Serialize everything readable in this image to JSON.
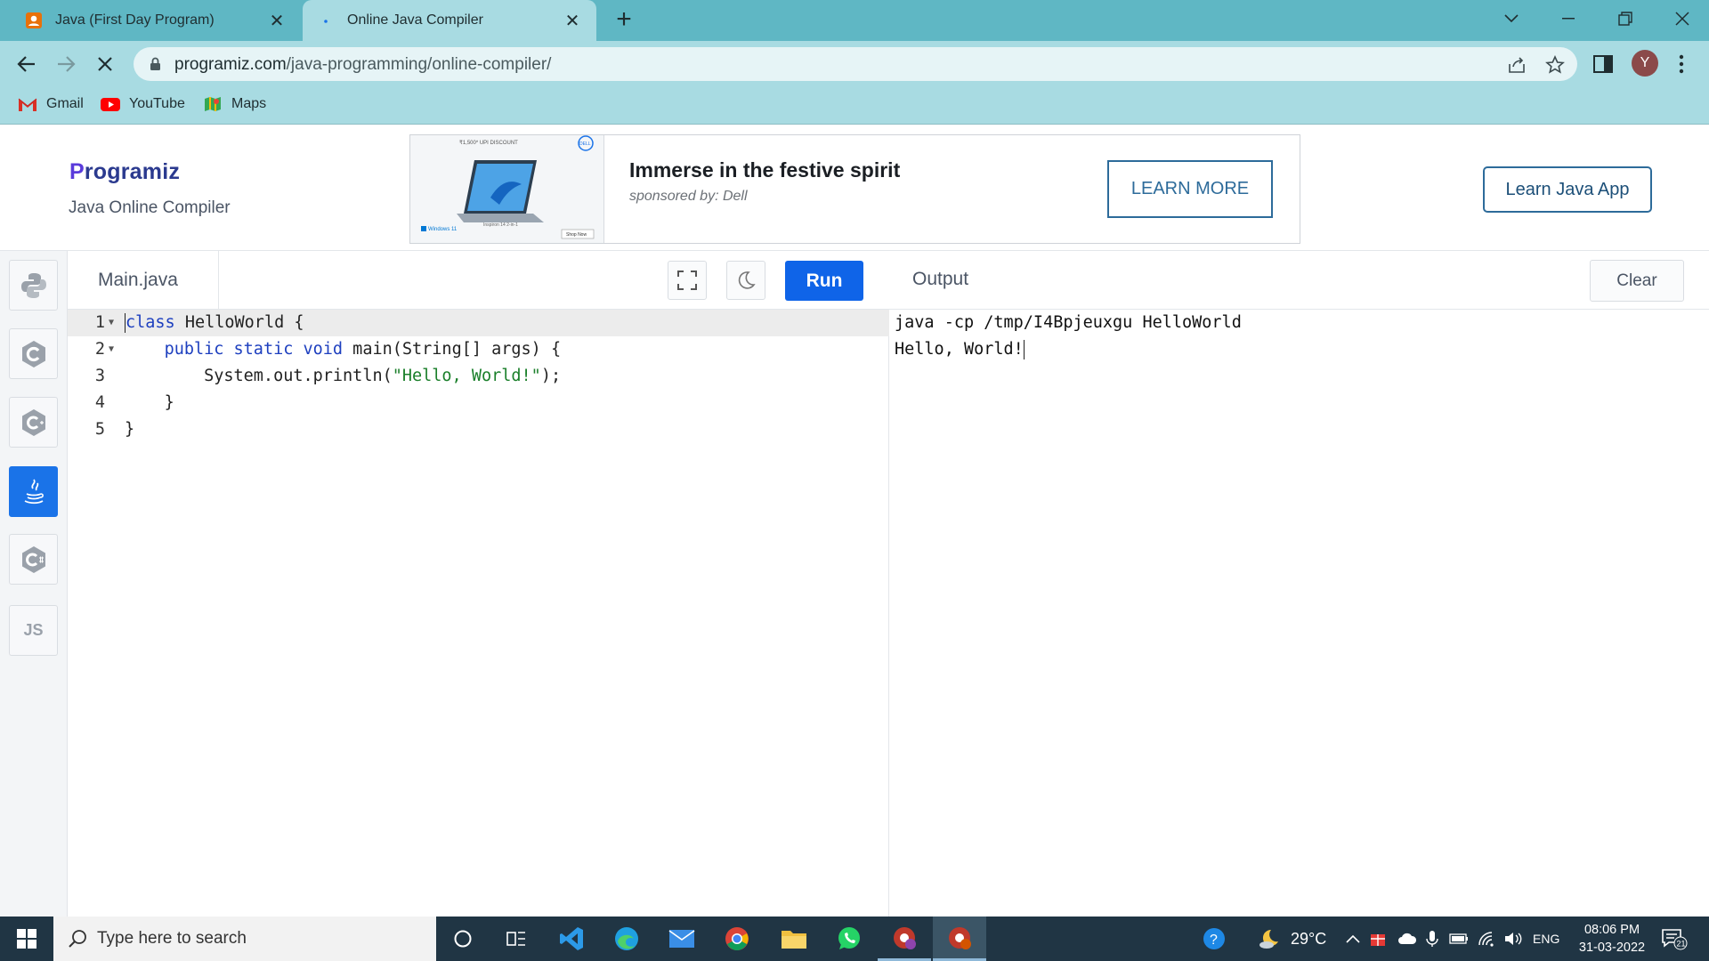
{
  "browser": {
    "tabs": [
      {
        "title": "Java (First Day Program)",
        "icon": "person-badge-icon",
        "active": false
      },
      {
        "title": "Online Java Compiler",
        "icon": "loading-dot-icon",
        "active": true
      }
    ],
    "url_domain": "programiz.com",
    "url_path": "/java-programming/online-compiler/",
    "profile_initial": "Y",
    "bookmarks": [
      {
        "label": "Gmail",
        "icon": "gmail-icon"
      },
      {
        "label": "YouTube",
        "icon": "youtube-icon"
      },
      {
        "label": "Maps",
        "icon": "maps-icon"
      }
    ]
  },
  "header": {
    "logo": "rogramiz",
    "logo_mark": "P",
    "subtitle": "Java Online Compiler",
    "ad": {
      "headline": "Immerse in the festive spirit",
      "sponsor": "sponsored by: Dell",
      "cta": "LEARN MORE",
      "image_badge": "DELL",
      "image_offer": "₹1,500* UPI DISCOUNT",
      "image_brand": "Windows 11",
      "image_model": "Inspiron 14 2-in-1",
      "image_shop": "Shop Now"
    },
    "learn_app": "Learn Java App"
  },
  "sidebar": {
    "languages": [
      {
        "name": "python",
        "label": ""
      },
      {
        "name": "c",
        "label": ""
      },
      {
        "name": "cpp",
        "label": ""
      },
      {
        "name": "java",
        "label": "",
        "active": true
      },
      {
        "name": "csharp",
        "label": ""
      },
      {
        "name": "javascript",
        "label": "JS"
      }
    ]
  },
  "editor": {
    "file_name": "Main.java",
    "run_label": "Run",
    "lines": [
      {
        "num": "1",
        "kw": "class",
        "rest": " HelloWorld {"
      },
      {
        "num": "2",
        "indent": "    ",
        "kw": "public static void",
        "rest": " main(String[] args) {"
      },
      {
        "num": "3",
        "indent": "        ",
        "pre": "System.out.println(",
        "str": "\"Hello, World!\"",
        "post": ");"
      },
      {
        "num": "4",
        "indent": "    ",
        "rest": "}"
      },
      {
        "num": "5",
        "rest": "}"
      }
    ]
  },
  "output": {
    "title": "Output",
    "clear_label": "Clear",
    "lines": [
      "java -cp /tmp/I4Bpjeuxgu HelloWorld",
      "Hello, World!"
    ]
  },
  "taskbar": {
    "search_placeholder": "Type here to search",
    "weather": "29°C",
    "language": "ENG",
    "time": "08:06 PM",
    "date": "31-03-2022",
    "notifications": "21"
  }
}
